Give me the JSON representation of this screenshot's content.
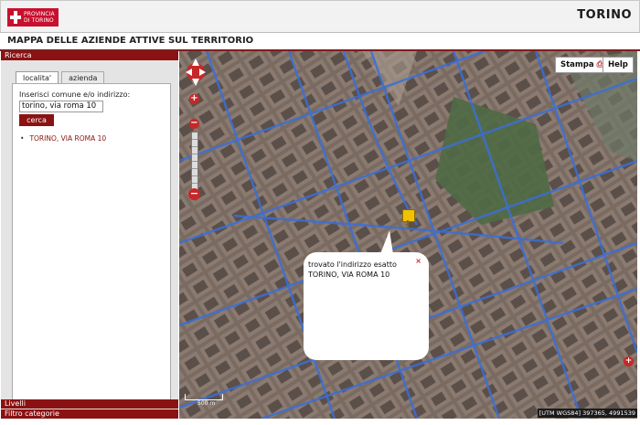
{
  "header": {
    "logo_line1": "PROVINCIA",
    "logo_line2": "DI TORINO",
    "city": "TORINO",
    "page_title": "MAPPA DELLE AZIENDE ATTIVE SUL TERRITORIO"
  },
  "sidebar": {
    "search_section": "Ricerca",
    "tabs": [
      {
        "label": "localita'",
        "active": true
      },
      {
        "label": "azienda",
        "active": false
      }
    ],
    "search_label": "Inserisci comune e/o indirizzo:",
    "search_value": "torino, via roma 10",
    "search_button": "cerca",
    "results": [
      "TORINO, VIA ROMA 10"
    ],
    "bottom_sections": [
      "Livelli",
      "Filtro categorie"
    ]
  },
  "map": {
    "print_button": "Stampa",
    "help_button": "Help",
    "popup_line1": "trovato l'indirizzo esatto",
    "popup_line2": "TORINO, VIA ROMA 10",
    "popup_close": "×",
    "coordinates": "[UTM WGS84] 397365, 4991539",
    "scale_label": "500 m",
    "zoom_in_label": "+",
    "zoom_out_label": "−",
    "slider_label": "−",
    "expand_label": "+"
  },
  "colors": {
    "brand_red": "#8a1212",
    "logo_red": "#c8102e",
    "control_red": "#c62828",
    "marker_yellow": "#f2c200",
    "streets_blue": "#3a6fd8"
  }
}
